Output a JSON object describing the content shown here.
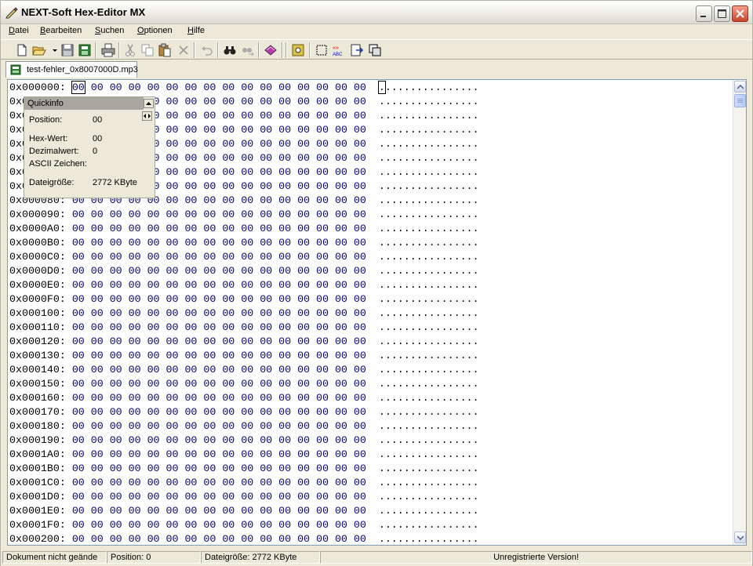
{
  "window": {
    "title": "NEXT-Soft Hex-Editor MX"
  },
  "menu": [
    {
      "label": "Datei"
    },
    {
      "label": "Bearbeiten"
    },
    {
      "label": "Suchen"
    },
    {
      "label": "Optionen"
    },
    {
      "label": "Hilfe"
    }
  ],
  "toolbar": {
    "icons": [
      "new-file-icon",
      "open-folder-icon",
      "dropdown-arrow-icon",
      "save-icon",
      "save-all-icon",
      "print-icon",
      "cut-icon",
      "copy-icon",
      "paste-icon",
      "delete-icon",
      "undo-icon",
      "find-icon",
      "find-next-icon",
      "bookmark-book-icon",
      "gear-tool-icon",
      "select-box-icon",
      "text-convert-icon",
      "export-icon",
      "copy-window-icon"
    ]
  },
  "tab": {
    "label": "test-fehler_0x8007000D.mp3"
  },
  "hex": {
    "bytes": "00 00 00 00 00 00 00 00 00 00 00 00 00 00 00 00",
    "ascii_first": ".",
    "ascii_rest": "...............",
    "rows": [
      {
        "addr": "0x000000:"
      },
      {
        "addr": "0x000010:"
      },
      {
        "addr": "0x000020:"
      },
      {
        "addr": "0x000030:"
      },
      {
        "addr": "0x000040:"
      },
      {
        "addr": "0x000050:"
      },
      {
        "addr": "0x000060:"
      },
      {
        "addr": "0x000070:"
      },
      {
        "addr": "0x000080:"
      },
      {
        "addr": "0x000090:"
      },
      {
        "addr": "0x0000A0:"
      },
      {
        "addr": "0x0000B0:"
      },
      {
        "addr": "0x0000C0:"
      },
      {
        "addr": "0x0000D0:"
      },
      {
        "addr": "0x0000E0:"
      },
      {
        "addr": "0x0000F0:"
      },
      {
        "addr": "0x000100:"
      },
      {
        "addr": "0x000110:"
      },
      {
        "addr": "0x000120:"
      },
      {
        "addr": "0x000130:"
      },
      {
        "addr": "0x000140:"
      },
      {
        "addr": "0x000150:"
      },
      {
        "addr": "0x000160:"
      },
      {
        "addr": "0x000170:"
      },
      {
        "addr": "0x000180:"
      },
      {
        "addr": "0x000190:"
      },
      {
        "addr": "0x0001A0:"
      },
      {
        "addr": "0x0001B0:"
      },
      {
        "addr": "0x0001C0:"
      },
      {
        "addr": "0x0001D0:"
      },
      {
        "addr": "0x0001E0:"
      },
      {
        "addr": "0x0001F0:"
      },
      {
        "addr": "0x000200:"
      }
    ]
  },
  "quickinfo": {
    "title": "Quickinfo",
    "position_label": "Position:",
    "position_value": "00",
    "hexwert_label": "Hex-Wert:",
    "hexwert_value": "00",
    "dezimal_label": "Dezimalwert:",
    "dezimal_value": "0",
    "ascii_label": "ASCII Zeichen:",
    "ascii_value": "",
    "dateigroesse_label": "Dateigröße:",
    "dateigroesse_value": "2772 KByte"
  },
  "status": {
    "doc_state": "Dokument nicht geände",
    "position": "Position: 0",
    "filesize": "Dateigröße: 2772 KByte",
    "empty": "",
    "registration": "Unregistrierte Version!"
  },
  "colors": {
    "hex_bytes": "#000080",
    "background": "#ece9d8"
  }
}
